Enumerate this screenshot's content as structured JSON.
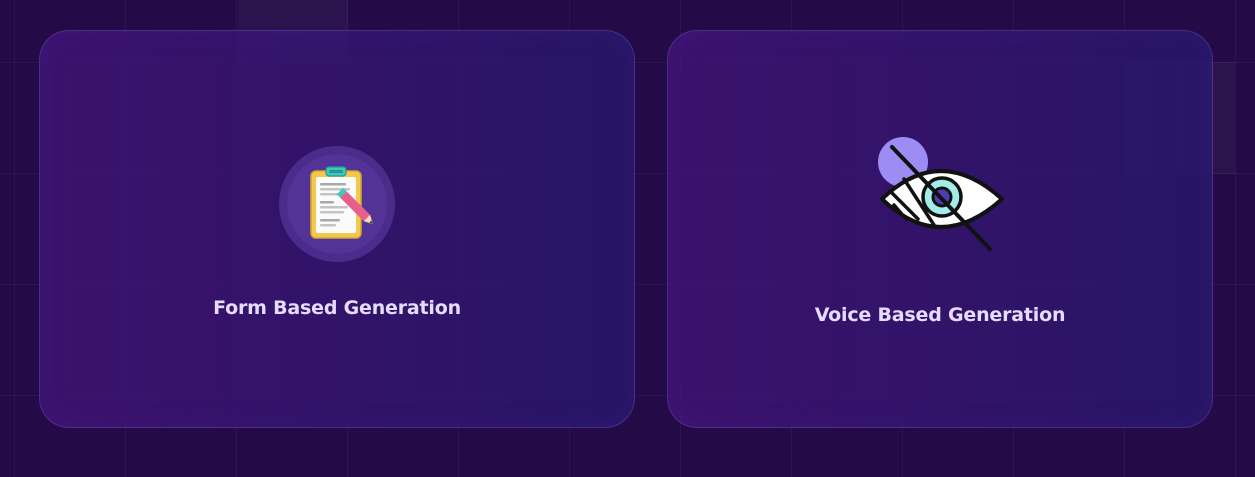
{
  "cards": [
    {
      "label": "Form Based Generation",
      "icon": "clipboard-pencil-icon"
    },
    {
      "label": "Voice Based Generation",
      "icon": "eye-slash-icon"
    }
  ],
  "colors": {
    "background": "#240b47",
    "card_start": "#42147a",
    "card_end": "#28186e",
    "label": "#e6dcff"
  }
}
